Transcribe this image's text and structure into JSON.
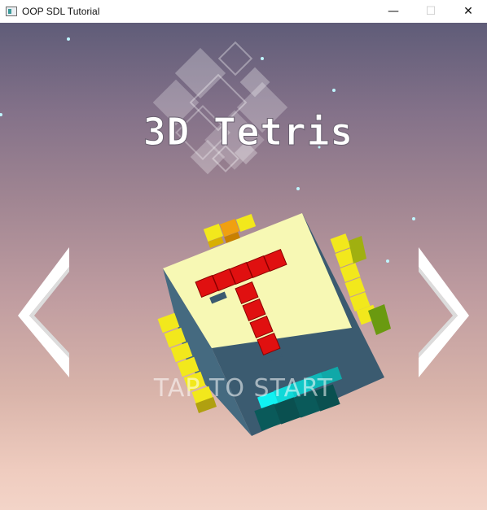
{
  "window": {
    "title": "OOP SDL Tutorial",
    "icon": "app-window-icon",
    "controls": {
      "minimize": "—",
      "maximize": "☐",
      "close": "✕"
    }
  },
  "game": {
    "logo_text": "3D Tetris",
    "cube_letter": "T",
    "start_prompt": "TAP TO START",
    "arrows": {
      "left": "chevron-left-icon",
      "right": "chevron-right-icon"
    },
    "colors": {
      "background_top": "#5f5c78",
      "background_bottom": "#f3d4c8",
      "cube_face": "#f7f8b4",
      "cube_side": "#3a5a70",
      "red_block": "#e01010",
      "yellow_block": "#f2e81c",
      "cyan_block": "#10f2f2",
      "orange_block": "#f0a010"
    }
  }
}
